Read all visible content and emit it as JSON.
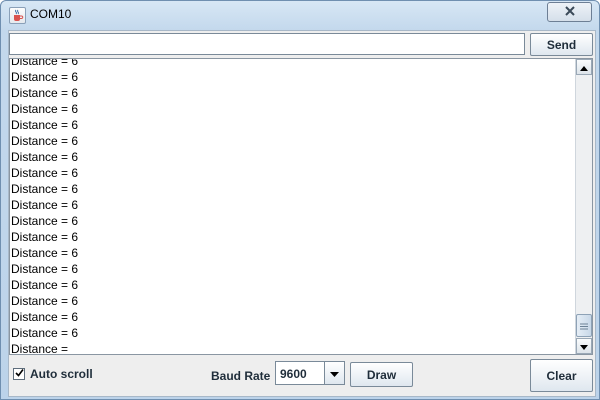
{
  "window": {
    "title": "COM10"
  },
  "input": {
    "value": "",
    "placeholder": ""
  },
  "buttons": {
    "send": "Send",
    "draw": "Draw",
    "clear": "Clear"
  },
  "console": {
    "lines": [
      "Distance = 6",
      "Distance = 6",
      "Distance = 6",
      "Distance = 6",
      "Distance = 6",
      "Distance = 6",
      "Distance = 6",
      "Distance = 6",
      "Distance = 6",
      "Distance = 6",
      "Distance = 6",
      "Distance = 6",
      "Distance = 6",
      "Distance = 6",
      "Distance = 6",
      "Distance = 6",
      "Distance = 6",
      "Distance = 6",
      "Distance = "
    ]
  },
  "autoscroll": {
    "label": "Auto scroll",
    "checked": true
  },
  "baud": {
    "label": "Baud Rate",
    "value": "9600"
  },
  "icons": {
    "app": "java-cup-icon",
    "close": "close-icon",
    "scroll_up": "arrow-up-icon",
    "scroll_down": "arrow-down-icon",
    "dropdown": "chevron-down-icon",
    "check": "checkmark-icon"
  },
  "colors": {
    "title_gradient": "#c3d8ec",
    "button_text": "#1f2d3a"
  }
}
